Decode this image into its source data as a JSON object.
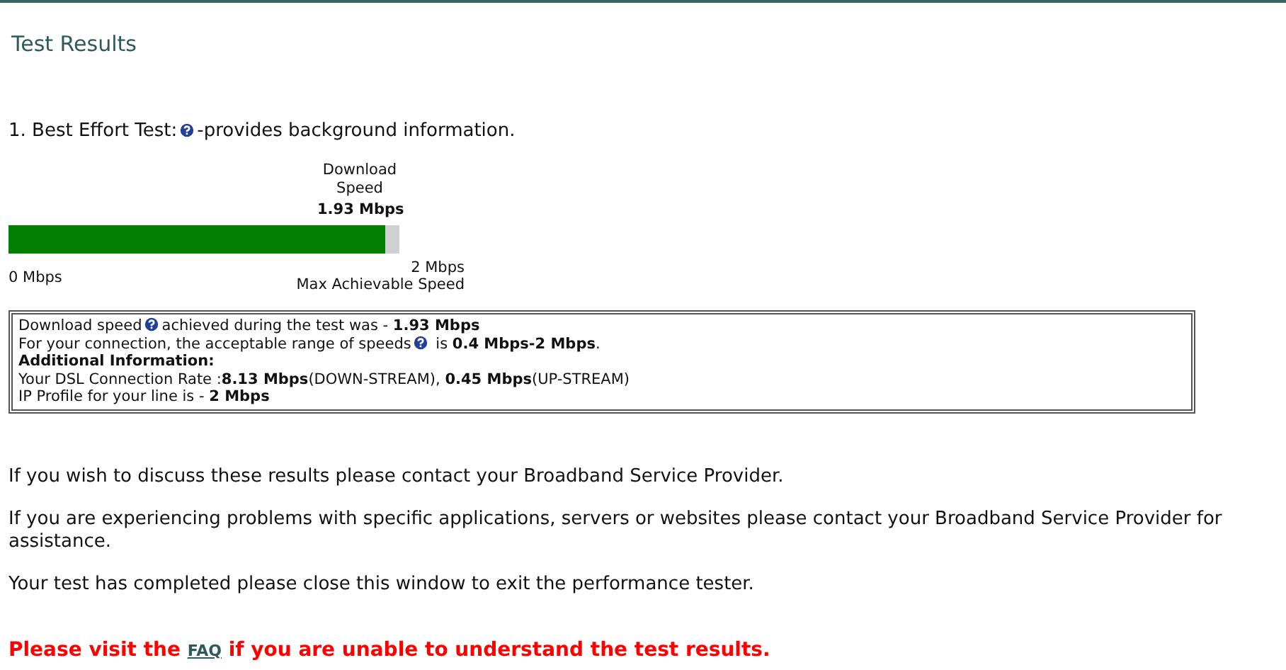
{
  "title": "Test Results",
  "test_heading": {
    "segments": [
      "1. Best Effort Test:",
      "-provides background information."
    ]
  },
  "speed_bar": {
    "label": "Download Speed",
    "value": "1.93 Mbps",
    "level": 0.965,
    "min_label": "0 Mbps",
    "max_label": "2 Mbps",
    "max_caption": "Max Achievable Speed"
  },
  "info_box": {
    "lines": [
      {
        "kind": "text",
        "segments": [
          "Download speed",
          "achieved during the test was - **1.93 Mbps**"
        ]
      },
      {
        "kind": "text",
        "segments": [
          "For your connection, the acceptable range of speeds",
          " is **0.4 Mbps-2 Mbps**."
        ]
      },
      {
        "kind": "heading",
        "segments": [
          "Additional Information:"
        ]
      },
      {
        "kind": "text",
        "segments": [
          "Your DSL Connection Rate :**8.13 Mbps**(DOWN-STREAM), **0.45 Mbps**(UP-STREAM)"
        ]
      },
      {
        "kind": "text",
        "segments": [
          "IP Profile for your line is - **2 Mbps**"
        ]
      }
    ]
  },
  "paragraphs": [
    "If you wish to discuss these results please contact your Broadband Service Provider.",
    "If you are experiencing problems with specific applications, servers or websites please contact your Broadband Service Provider for assistance.",
    "Your test has completed please close this window to exit the performance tester."
  ],
  "faq_notice": {
    "before": "Please visit the",
    "link": "FAQ",
    "after": "if you are unable to understand the test results."
  }
}
